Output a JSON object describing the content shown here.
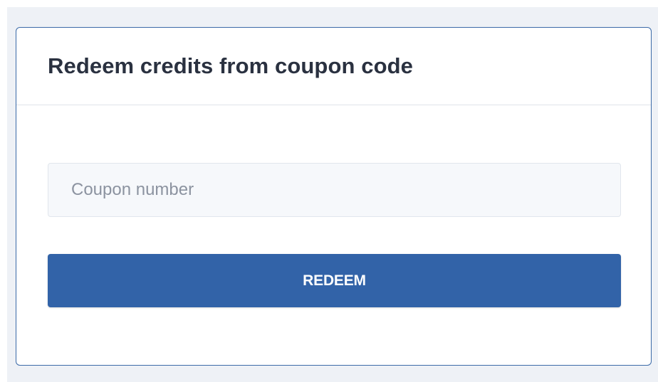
{
  "card": {
    "title": "Redeem credits from coupon code"
  },
  "coupon_field": {
    "placeholder": "Coupon number",
    "value": ""
  },
  "redeem_button": {
    "label": "REDEEM"
  },
  "colors": {
    "page_background": "#eef1f6",
    "card_border": "#3b6aa8",
    "button_background": "#3263a8",
    "button_text": "#ffffff",
    "title_text": "#2a3140",
    "input_background": "#f6f8fb",
    "placeholder_text": "#8c93a0"
  }
}
